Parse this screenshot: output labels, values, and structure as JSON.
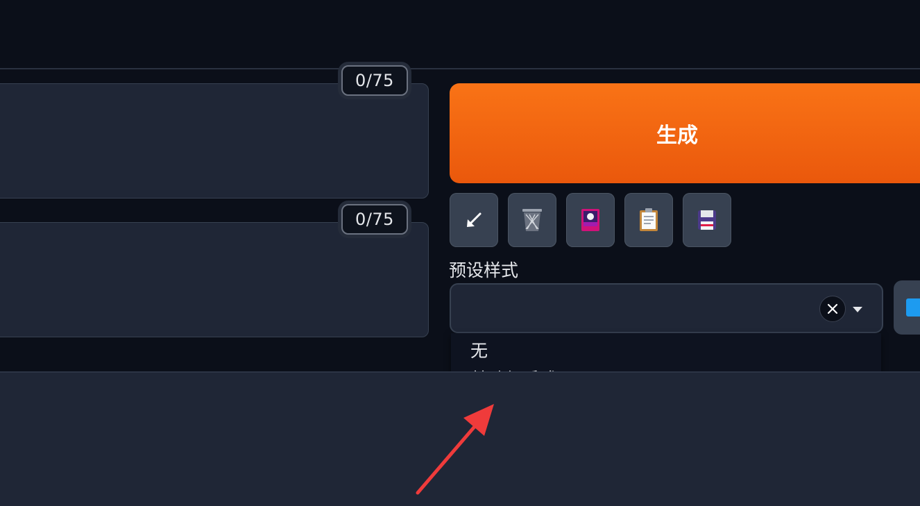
{
  "prompts": {
    "positive_counter": "0/75",
    "negative_counter": "0/75"
  },
  "toolbar": {
    "generate_label": "生成",
    "tools": [
      {
        "name": "arrow-paste-icon"
      },
      {
        "name": "trash-icon"
      },
      {
        "name": "image-card-icon"
      },
      {
        "name": "clipboard-icon"
      },
      {
        "name": "floppy-disk-icon"
      }
    ]
  },
  "styles": {
    "label": "预设样式",
    "selected": "",
    "options": [
      "无",
      "基础起手式"
    ]
  },
  "colors": {
    "accent": "#f97316",
    "background": "#0b0f19",
    "panel": "#1f2636",
    "annotation": "#ef3b3b"
  }
}
